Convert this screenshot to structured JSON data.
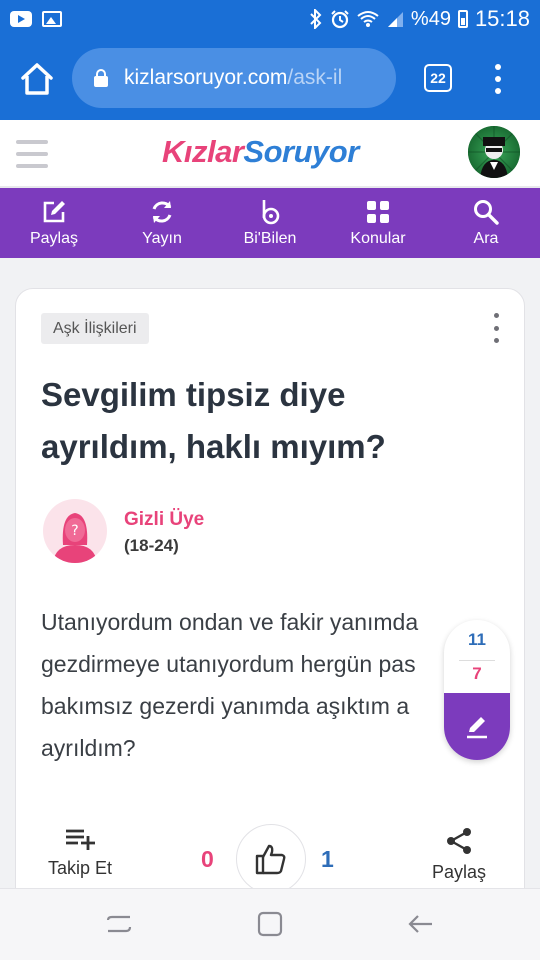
{
  "status_bar": {
    "battery": "%49",
    "time": "15:18"
  },
  "browser": {
    "url_domain": "kizlarsoruyor.com",
    "url_path": "/ask-il",
    "tab_count": "22"
  },
  "site": {
    "logo_part1": "Kızlar",
    "logo_part2": "Soruyor"
  },
  "nav": [
    {
      "label": "Paylaş",
      "icon": "edit-icon"
    },
    {
      "label": "Yayın",
      "icon": "refresh-icon"
    },
    {
      "label": "Bi'Bilen",
      "icon": "bibilen-icon"
    },
    {
      "label": "Konular",
      "icon": "grid-icon"
    },
    {
      "label": "Ara",
      "icon": "search-icon"
    }
  ],
  "question": {
    "category": "Aşk İlişkileri",
    "title": "Sevgilim tipsiz diye ayrıldım, haklı mıyım?",
    "author_name": "Gizli Üye",
    "author_age": "(18-24)",
    "body_lines": [
      "Utanıyordum ondan ve fakir yanımda",
      "gezdirmeye utanıyordum hergün pas",
      "bakımsız gezerdi yanımda aşıktım a",
      "ayrıldım?"
    ]
  },
  "vote_widget": {
    "count_a": "11",
    "count_b": "7"
  },
  "actions": {
    "follow_label": "Takip Et",
    "dislike_count": "0",
    "like_count": "1",
    "share_label": "Paylaş"
  },
  "colors": {
    "browser_blue": "#1a6fd6",
    "brand_purple": "#7c3bbd",
    "brand_pink": "#e8437a",
    "brand_blue": "#2e7fd6"
  }
}
